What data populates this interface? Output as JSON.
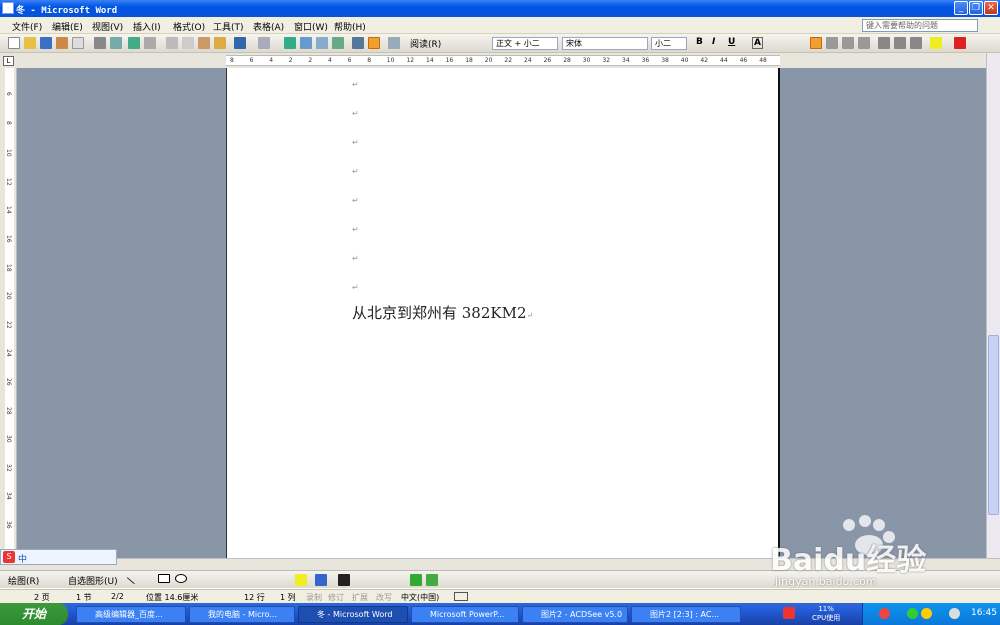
{
  "window": {
    "title": "冬 - Microsoft Word"
  },
  "menus": [
    "文件(F)",
    "编辑(E)",
    "视图(V)",
    "插入(I)",
    "格式(O)",
    "工具(T)",
    "表格(A)",
    "窗口(W)",
    "帮助(H)"
  ],
  "help_placeholder": "键入需要帮助的问题",
  "toolbar": {
    "read_label": "阅读(R)",
    "style": "正文 + 小二",
    "font": "宋体",
    "size": "小二",
    "bold": "B",
    "italic": "I",
    "underline": "U",
    "charscale": "A"
  },
  "ruler": {
    "h_ticks": [
      "8",
      "6",
      "4",
      "2",
      "2",
      "4",
      "6",
      "8",
      "10",
      "12",
      "14",
      "16",
      "18",
      "20",
      "22",
      "24",
      "26",
      "28",
      "30",
      "32",
      "34",
      "36",
      "38",
      "40",
      "42",
      "44",
      "46",
      "48"
    ],
    "v_ticks": [
      "6",
      "8",
      "10",
      "12",
      "14",
      "16",
      "18",
      "20",
      "22",
      "24",
      "26",
      "28",
      "30",
      "32",
      "34",
      "36",
      "38"
    ]
  },
  "document": {
    "paragraph_mark": "↵",
    "text": "从北京到郑州有 382KM2"
  },
  "drawbar": {
    "draw_label": "绘图(R)",
    "autoshape_label": "自选图形(U)"
  },
  "statusbar": {
    "page": "2 页",
    "section": "1 节",
    "pages": "2/2",
    "position": "位置 14.6厘米",
    "line": "12 行",
    "col": "1 列",
    "rec": "录制",
    "trk": "修订",
    "ext": "扩展",
    "ovr": "改写",
    "lang": "中文(中国)"
  },
  "taskbar": {
    "start": "开始",
    "tasks": [
      "高级编辑器_百度...",
      "我的电脑 - Micro...",
      "冬 - Microsoft Word",
      "Microsoft PowerP...",
      "图片2 - ACDSee v5.0",
      "图片2 [2:3] : AC..."
    ],
    "cpu": "11%",
    "cpu_label": "CPU使用",
    "clock": "16:45"
  },
  "watermark": {
    "brand": "Baidu经验",
    "url": "jingyan.baidu.com"
  },
  "colors": {
    "title_blue": "#0a53d8",
    "gray_bg": "#8996a8",
    "taskbar_blue": "#245edb",
    "start_green": "#2e8a2e"
  }
}
